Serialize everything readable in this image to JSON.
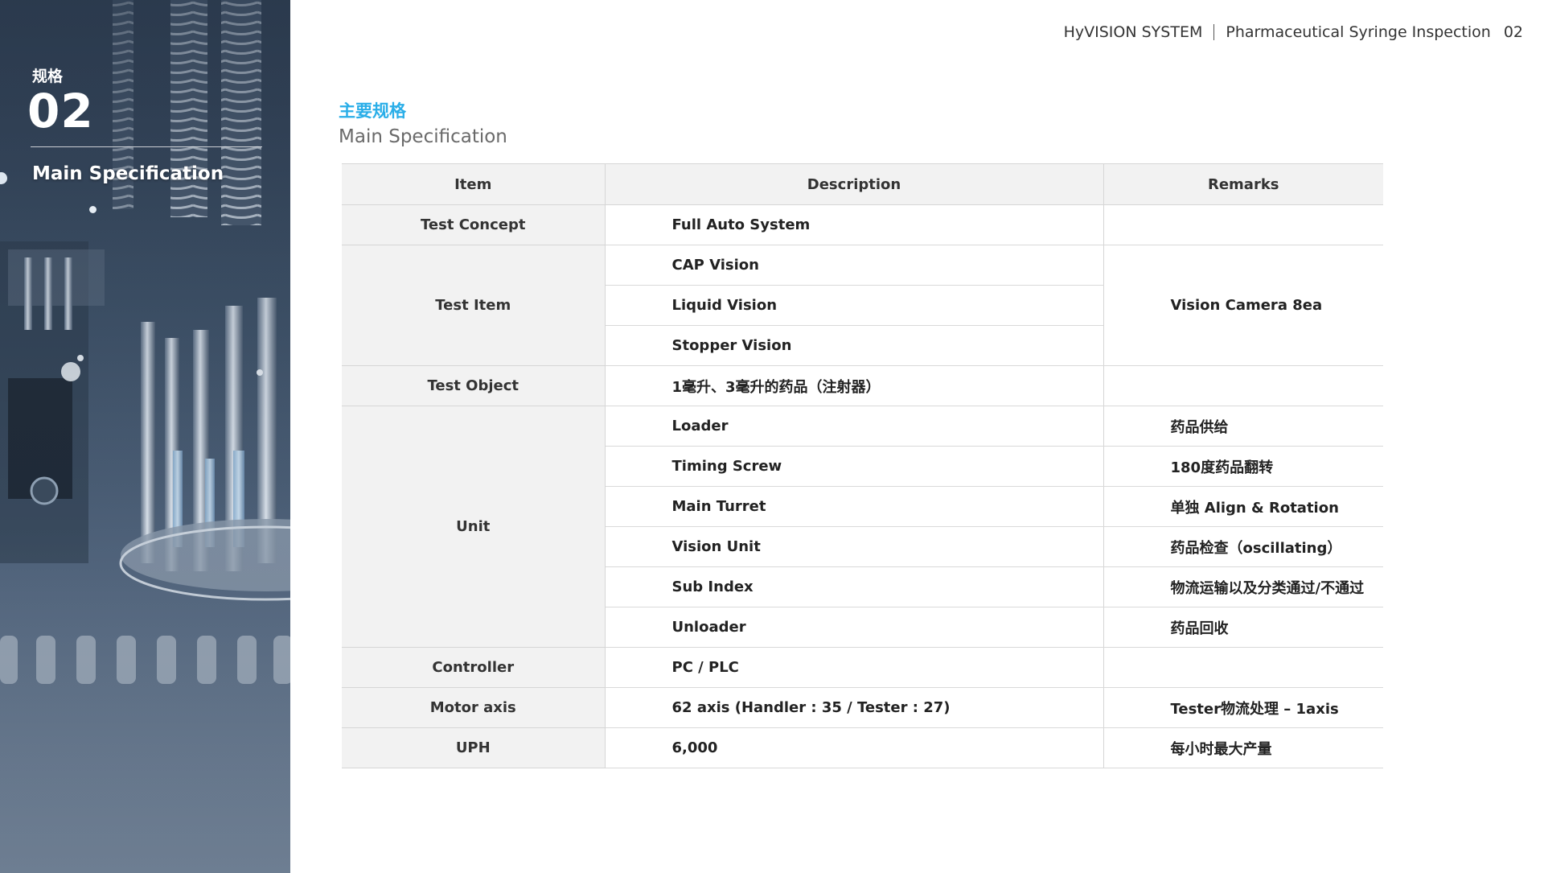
{
  "header": {
    "brand": "HyVISION SYSTEM",
    "document": "Pharmaceutical Syringe Inspection",
    "page_number": "02"
  },
  "sidebar": {
    "chinese_label": "规格",
    "section_number": "02",
    "section_title": "Main Specification"
  },
  "section": {
    "title_cn": "主要规格",
    "title_en": "Main Specification"
  },
  "table": {
    "headers": [
      "Item",
      "Description",
      "Remarks"
    ],
    "rows": {
      "test_concept": {
        "item": "Test Concept",
        "description": "Full Auto System",
        "remarks": ""
      },
      "test_item": {
        "item": "Test Item",
        "descriptions": [
          "CAP Vision",
          "Liquid Vision",
          "Stopper Vision"
        ],
        "remarks": "Vision Camera 8ea"
      },
      "test_object": {
        "item": "Test Object",
        "description": "1毫升、3毫升的药品（注射器）",
        "remarks": ""
      },
      "unit": {
        "item": "Unit",
        "entries": [
          {
            "description": "Loader",
            "remarks": "药品供给"
          },
          {
            "description": "Timing Screw",
            "remarks": "180度药品翻转"
          },
          {
            "description": "Main Turret",
            "remarks": "单独 Align & Rotation"
          },
          {
            "description": "Vision Unit",
            "remarks": "药品检查（oscillating）"
          },
          {
            "description": "Sub Index",
            "remarks": "物流运输以及分类通过/不通过"
          },
          {
            "description": "Unloader",
            "remarks": "药品回收"
          }
        ]
      },
      "controller": {
        "item": "Controller",
        "description": "PC / PLC",
        "remarks": ""
      },
      "motor_axis": {
        "item": "Motor axis",
        "description": "62 axis (Handler : 35 / Tester : 27)",
        "remarks": "Tester物流处理 – 1axis"
      },
      "uph": {
        "item": "UPH",
        "description": "6,000",
        "remarks": "每小时最大产量"
      }
    }
  },
  "colors": {
    "accent": "#2aaee8",
    "header_fill": "#f2f2f2",
    "sidebar_bg": "#3d5066"
  }
}
